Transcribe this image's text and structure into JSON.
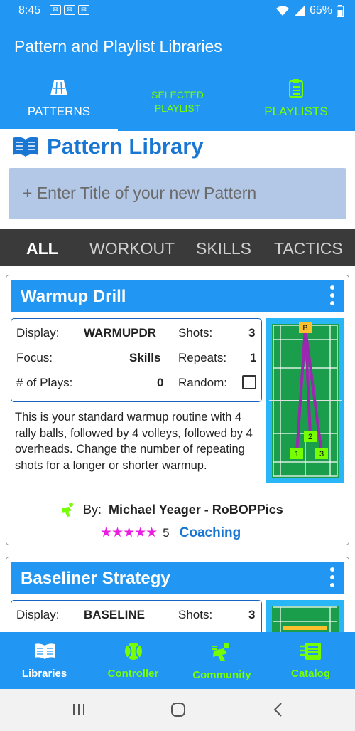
{
  "status": {
    "time": "8:45",
    "battery": "65%"
  },
  "app": {
    "title": "Pattern and Playlist Libraries"
  },
  "tabs": [
    {
      "label": "PATTERNS",
      "icon": "court-icon"
    },
    {
      "label_line1": "SELECTED",
      "label_line2": "PLAYLIST"
    },
    {
      "label": "PLAYLISTS",
      "icon": "clipboard-icon"
    }
  ],
  "library": {
    "title": "Pattern Library",
    "new_placeholder": "+ Enter Title of your new Pattern"
  },
  "filters": [
    "ALL",
    "WORKOUT",
    "SKILLS",
    "TACTICS"
  ],
  "cards": [
    {
      "name": "Warmup Drill",
      "display_label": "Display:",
      "display_value": "WARMUPDR",
      "shots_label": "Shots:",
      "shots_value": "3",
      "focus_label": "Focus:",
      "focus_value": "Skills",
      "repeats_label": "Repeats:",
      "repeats_value": "1",
      "plays_label": "# of Plays:",
      "plays_value": "0",
      "random_label": "Random:",
      "court_markers": [
        "B",
        "2",
        "1",
        "3"
      ],
      "description": "This is your standard warmup routine with 4 rally balls, followed by 4 volleys, followed by 4 overheads. Change the number of repeating shots for a longer or shorter warmup.",
      "by_label": "By:",
      "author": "Michael Yeager - RoBOPPics",
      "stars": "★★★★★",
      "rating": "5",
      "category": "Coaching"
    },
    {
      "name": "Baseliner Strategy",
      "display_label": "Display:",
      "display_value": "BASELINE",
      "shots_label": "Shots:",
      "shots_value": "3"
    }
  ],
  "bottom_nav": [
    "Libraries",
    "Controller",
    "Community",
    "Catalog"
  ],
  "colors": {
    "primary": "#2196F3",
    "accent": "#76FF03",
    "title": "#1976D2",
    "star": "#E91EE0",
    "court": "#1B9E4B"
  }
}
